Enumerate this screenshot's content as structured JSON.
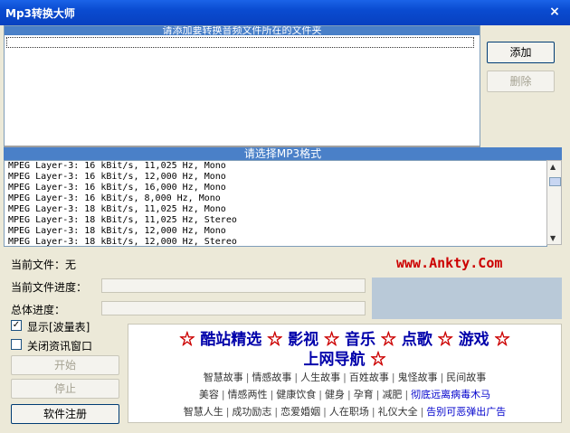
{
  "window": {
    "title": "Mp3转换大师",
    "close_glyph": "×"
  },
  "files_panel": {
    "header": "请添加要转换音频文件所在的文件夹"
  },
  "buttons": {
    "add": "添加",
    "delete": "删除",
    "start": "开始",
    "stop": "停止",
    "register": "软件注册"
  },
  "formats": {
    "header": "请选择MP3格式",
    "items": [
      "MPEG Layer-3: 16 kBit/s, 11,025 Hz, Mono",
      "MPEG Layer-3: 16 kBit/s, 12,000 Hz, Mono",
      "MPEG Layer-3: 16 kBit/s, 16,000 Hz, Mono",
      "MPEG Layer-3: 16 kBit/s, 8,000 Hz, Mono",
      "MPEG Layer-3: 18 kBit/s, 11,025 Hz, Mono",
      "MPEG Layer-3: 18 kBit/s, 11,025 Hz, Stereo",
      "MPEG Layer-3: 18 kBit/s, 12,000 Hz, Mono",
      "MPEG Layer-3: 18 kBit/s, 12,000 Hz, Stereo"
    ]
  },
  "status": {
    "current_file_label": "当前文件：无",
    "file_progress_label": "当前文件进度：",
    "total_progress_label": "总体进度："
  },
  "website": "www.Ankty.Com",
  "options": {
    "show_wave": {
      "label": "显示[波量表]",
      "checked": true
    },
    "close_news": {
      "label": "关闭资讯窗口",
      "checked": false
    }
  },
  "ad": {
    "nav": [
      "酷站精选",
      "影视",
      "音乐",
      "点歌",
      "游戏",
      "上网导航"
    ],
    "star": "☆",
    "row1": [
      "智慧故事",
      "情感故事",
      "人生故事",
      "百姓故事",
      "鬼怪故事",
      "民间故事"
    ],
    "row2": [
      "美容",
      "情感两性",
      "健康饮食",
      "健身",
      "孕育",
      "减肥"
    ],
    "row2_highlight": "彻底远离病毒木马",
    "row3": [
      "智慧人生",
      "成功励志",
      "恋爱婚姻",
      "人在职场",
      "礼仪大全"
    ],
    "row3_highlight": "告别可恶弹出广告"
  },
  "colors": {
    "title_bar": "#0a4bd0",
    "header_bar": "#4a80c8",
    "link": "#cc0000",
    "nav": "#0000aa"
  }
}
